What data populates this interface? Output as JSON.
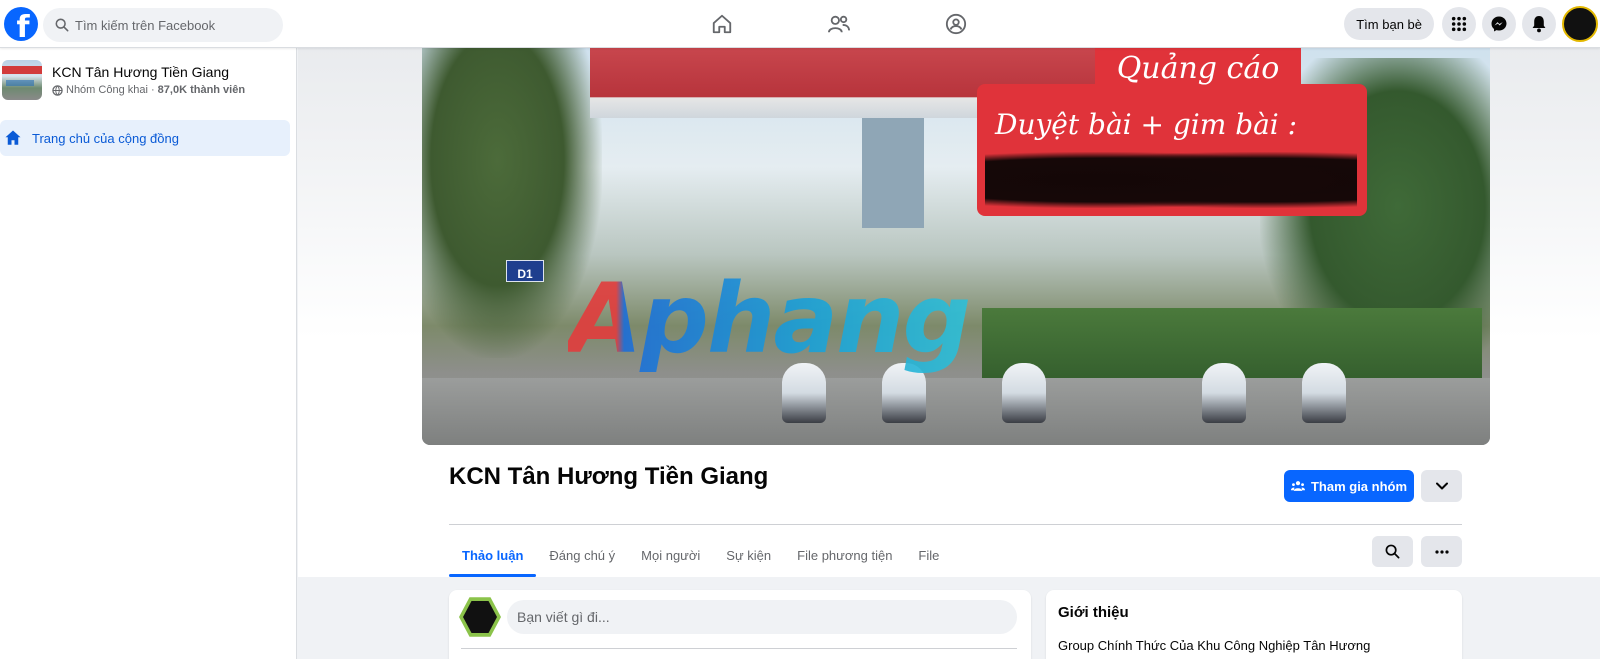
{
  "topbar": {
    "search_placeholder": "Tìm kiếm trên Facebook",
    "find_friends_label": "Tìm bạn bè",
    "brand_color": "#0866ff"
  },
  "sidebar": {
    "group_name": "KCN Tân Hương Tiền Giang",
    "privacy_label": "Nhóm Công khai ·",
    "member_count": "87,0K thành viên",
    "items": [
      {
        "label": "Trang chủ của cộng đồng",
        "icon": "home-icon"
      }
    ]
  },
  "cover": {
    "ad_title": "Quảng cáo",
    "ad_line": "Duyệt bài + gim bài :",
    "watermark": "Aphang",
    "sign_text": "D1"
  },
  "group": {
    "title": "KCN Tân Hương Tiền Giang",
    "join_label": "Tham gia nhóm"
  },
  "tabs": [
    {
      "label": "Thảo luận",
      "active": true
    },
    {
      "label": "Đáng chú ý"
    },
    {
      "label": "Mọi người"
    },
    {
      "label": "Sự kiện"
    },
    {
      "label": "File phương tiện"
    },
    {
      "label": "File"
    }
  ],
  "composer": {
    "placeholder": "Bạn viết gì đi..."
  },
  "intro": {
    "title": "Giới thiệu",
    "description": "Group Chính Thức Của Khu Công Nghiệp Tân Hương"
  }
}
